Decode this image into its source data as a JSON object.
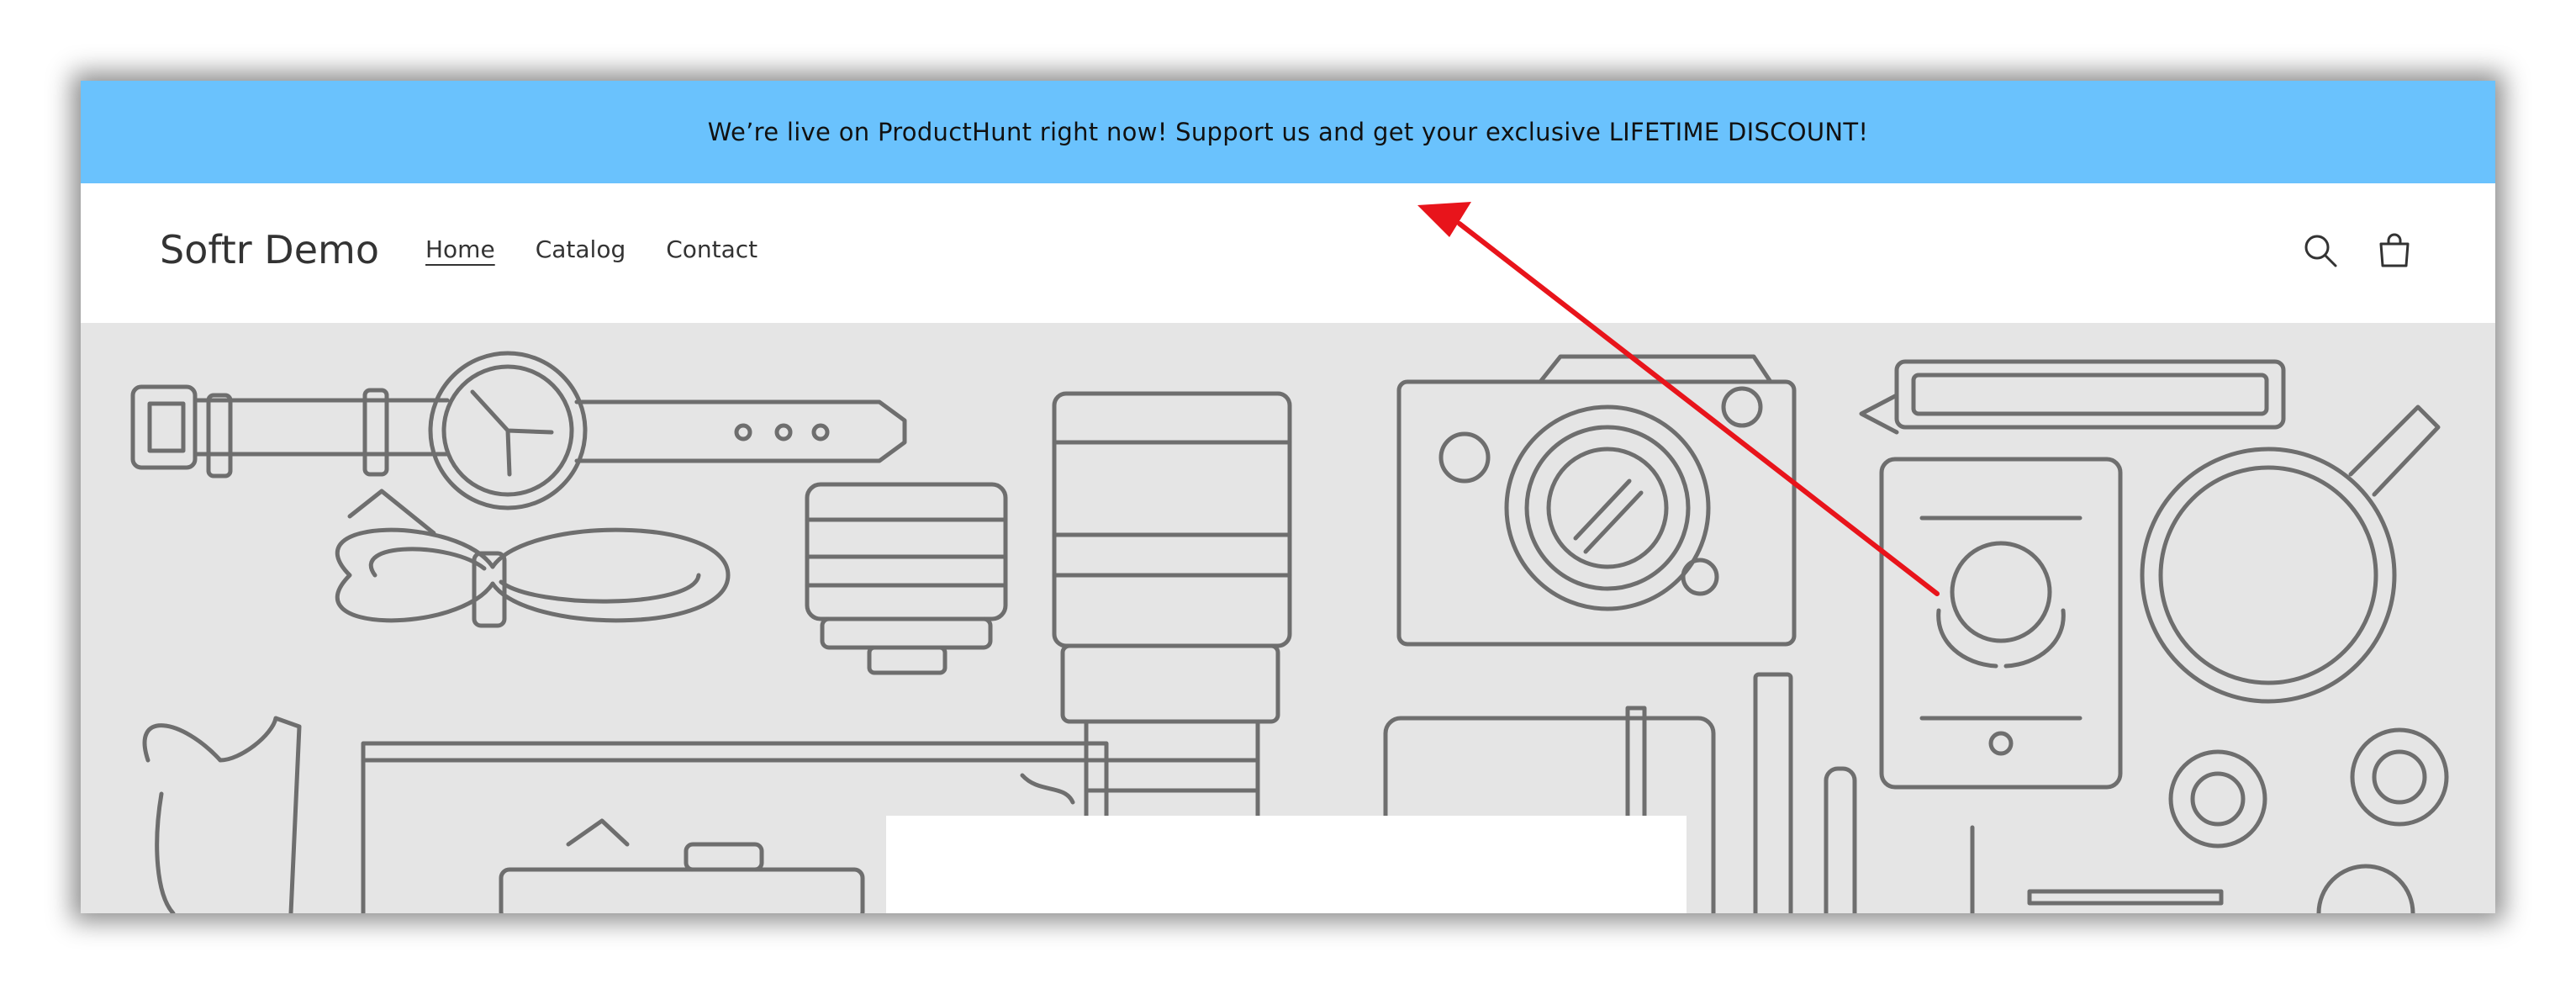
{
  "announcement": {
    "text": "We’re live on ProductHunt right now! Support us and get your exclusive LIFETIME DISCOUNT!",
    "background": "#6ac2fd"
  },
  "header": {
    "logo": "Softr Demo",
    "nav": [
      {
        "label": "Home",
        "active": true
      },
      {
        "label": "Catalog",
        "active": false
      },
      {
        "label": "Contact",
        "active": false
      }
    ],
    "icons": [
      "search-icon",
      "cart-icon"
    ]
  },
  "hero": {
    "background": "#e5e5e5",
    "line_color": "#6e6e6e",
    "illustration": "line-art products"
  },
  "annotation": {
    "arrow_color": "#e8141b"
  }
}
